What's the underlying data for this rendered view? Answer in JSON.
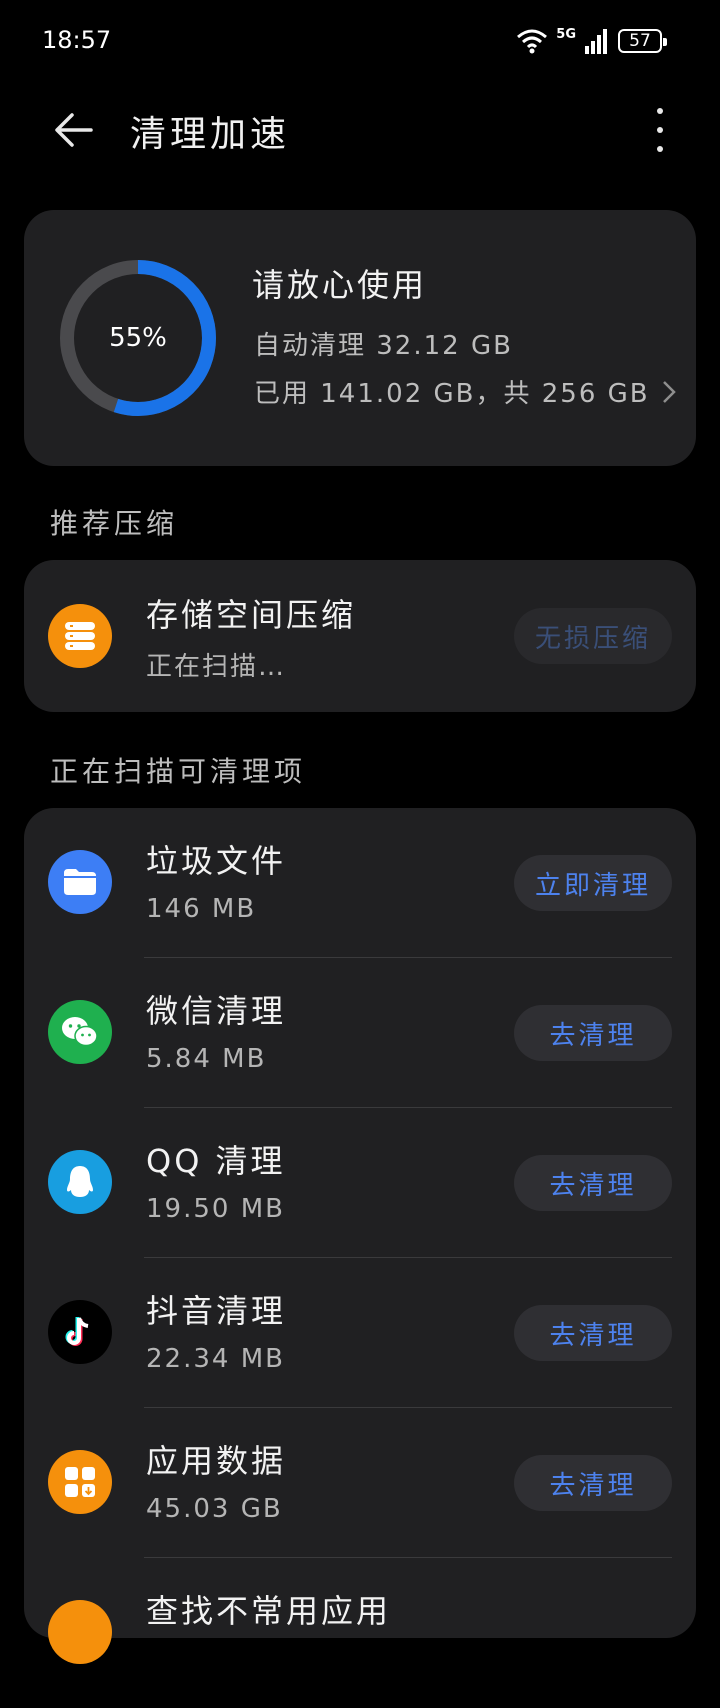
{
  "status_bar": {
    "time": "18:57",
    "network": "5G",
    "battery": "57"
  },
  "header": {
    "title": "清理加速"
  },
  "storage": {
    "percent_label": "55%",
    "percent": 55,
    "status": "请放心使用",
    "auto_clean": "自动清理 32.12 GB",
    "usage": "已用 141.02 GB，共 256 GB",
    "ring_color": "#1a73e8",
    "ring_track_color": "#4a4a4d"
  },
  "sections": {
    "recommend": "推荐压缩",
    "scanning": "正在扫描可清理项"
  },
  "compress": {
    "title": "存储空间压缩",
    "subtitle": "正在扫描…",
    "button": "无损压缩",
    "icon": "storage-stack-icon",
    "icon_color": "#f5900c"
  },
  "items": [
    {
      "title": "垃圾文件",
      "size": "146 MB",
      "button": "立即清理",
      "icon": "folder-icon",
      "icon_color": "#3d7ef5"
    },
    {
      "title": "微信清理",
      "size": "5.84 MB",
      "button": "去清理",
      "icon": "wechat-icon",
      "icon_color": "#1fb04f"
    },
    {
      "title": "QQ 清理",
      "size": "19.50 MB",
      "button": "去清理",
      "icon": "qq-icon",
      "icon_color": "#189ee0"
    },
    {
      "title": "抖音清理",
      "size": "22.34 MB",
      "button": "去清理",
      "icon": "tiktok-icon",
      "icon_color": "#000000"
    },
    {
      "title": "应用数据",
      "size": "45.03 GB",
      "button": "去清理",
      "icon": "app-grid-icon",
      "icon_color": "#f5900c"
    },
    {
      "title": "查找不常用应用",
      "icon": "app-search-icon",
      "icon_color": "#f5900c"
    }
  ]
}
